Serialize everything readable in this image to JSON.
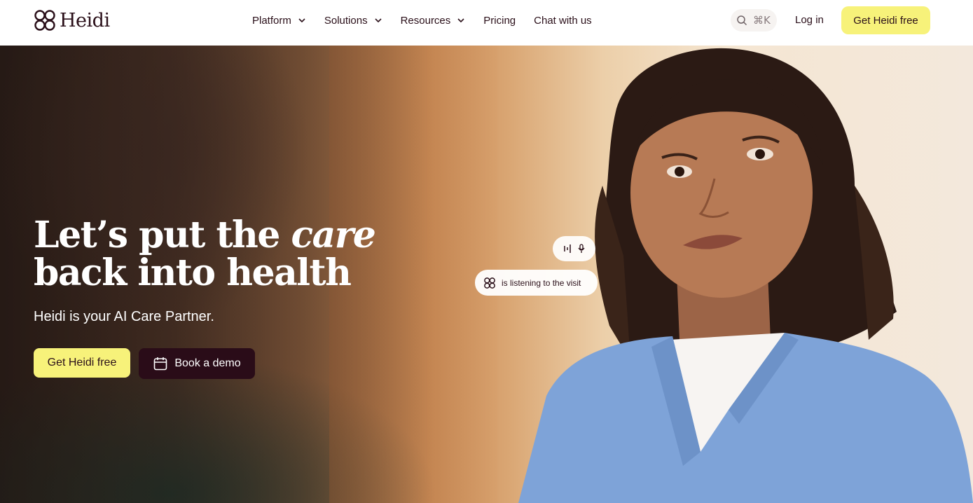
{
  "header": {
    "logo_text": "Heidi",
    "nav": [
      {
        "label": "Platform",
        "has_dropdown": true
      },
      {
        "label": "Solutions",
        "has_dropdown": true
      },
      {
        "label": "Resources",
        "has_dropdown": true
      },
      {
        "label": "Pricing",
        "has_dropdown": false
      },
      {
        "label": "Chat with us",
        "has_dropdown": false
      }
    ],
    "search_shortcut": "⌘K",
    "login_label": "Log in",
    "cta_label": "Get Heidi free"
  },
  "hero": {
    "headline_part1": "Let’s put the ",
    "headline_emphasis": "care",
    "headline_line2": "back into health",
    "subheadline": "Heidi is your AI Care Partner.",
    "primary_button": "Get Heidi free",
    "secondary_button": "Book a demo",
    "status_text": "is listening to the visit"
  },
  "colors": {
    "accent_yellow": "#f7f27a",
    "brand_dark": "#2a0c18",
    "scrubs_blue": "#7ea3d8"
  }
}
